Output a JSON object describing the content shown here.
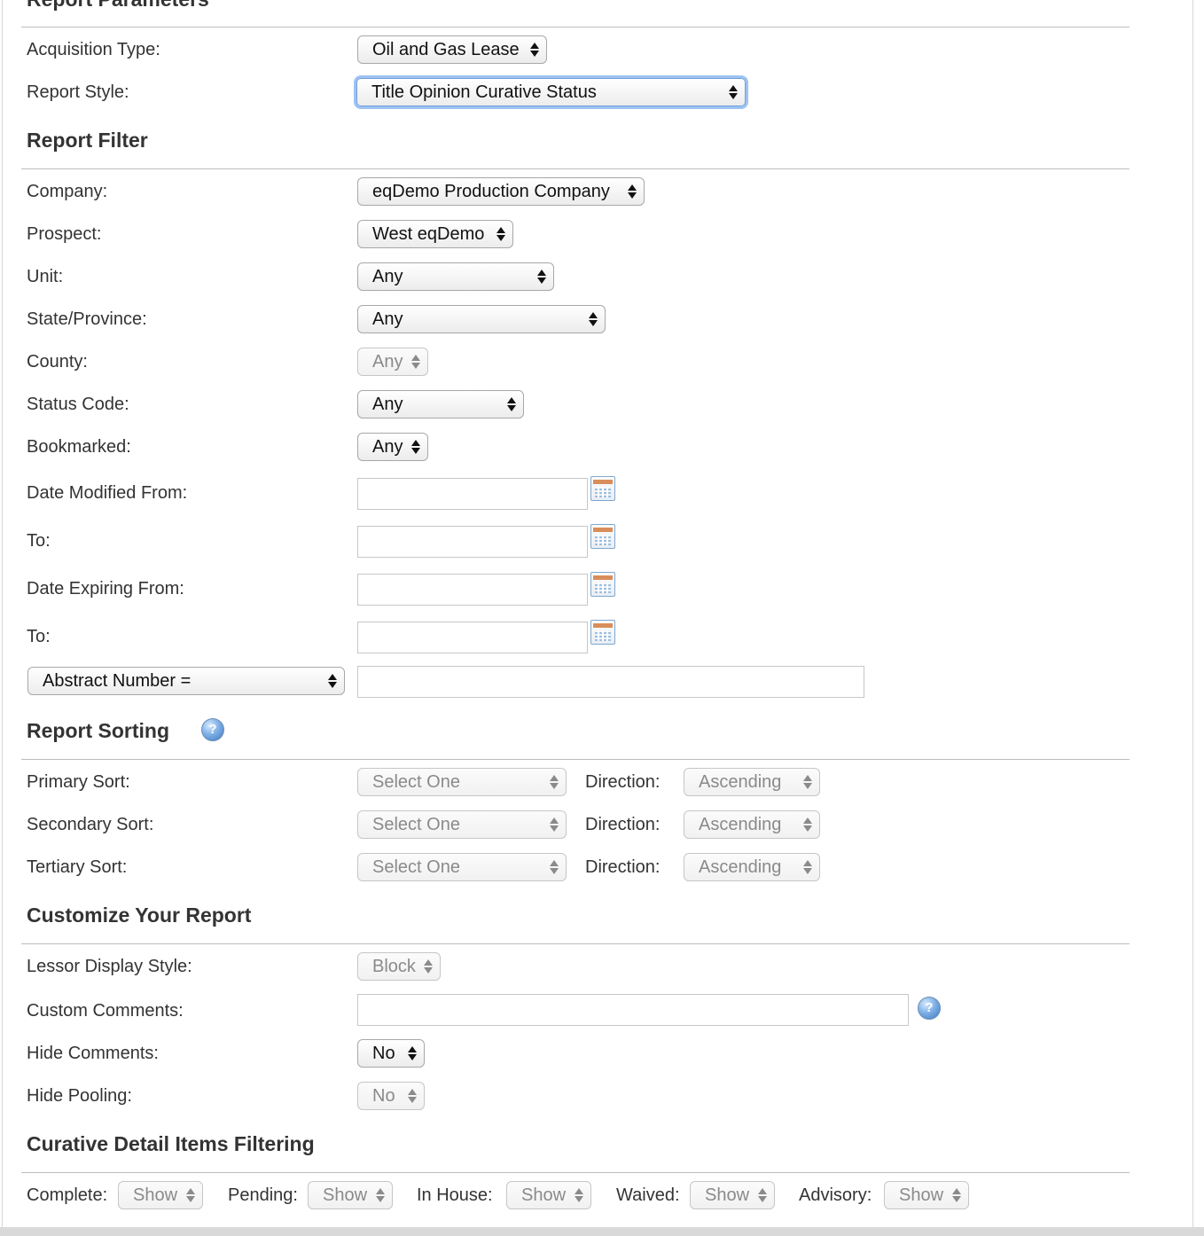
{
  "report_parameters": {
    "title": "Report Parameters",
    "acquisition_type": {
      "label": "Acquisition Type:",
      "value": "Oil and Gas Lease"
    },
    "report_style": {
      "label": "Report Style:",
      "value": "Title Opinion Curative Status"
    }
  },
  "report_filter": {
    "title": "Report Filter",
    "company": {
      "label": "Company:",
      "value": "eqDemo Production Company"
    },
    "prospect": {
      "label": "Prospect:",
      "value": "West eqDemo"
    },
    "unit": {
      "label": "Unit:",
      "value": "Any"
    },
    "state": {
      "label": "State/Province:",
      "value": "Any"
    },
    "county": {
      "label": "County:",
      "value": "Any"
    },
    "status_code": {
      "label": "Status Code:",
      "value": "Any"
    },
    "bookmarked": {
      "label": "Bookmarked:",
      "value": "Any"
    },
    "date_modified_from": {
      "label": "Date Modified From:",
      "value": ""
    },
    "date_modified_to": {
      "label": "To:",
      "value": ""
    },
    "date_expiring_from": {
      "label": "Date Expiring From:",
      "value": ""
    },
    "date_expiring_to": {
      "label": "To:",
      "value": ""
    },
    "field_selector": {
      "value": "Abstract Number ="
    },
    "field_value": ""
  },
  "report_sorting": {
    "title": "Report Sorting",
    "help_glyph": "?",
    "direction_label": "Direction:",
    "primary": {
      "label": "Primary Sort:",
      "value": "Select One",
      "direction": "Ascending"
    },
    "secondary": {
      "label": "Secondary Sort:",
      "value": "Select One",
      "direction": "Ascending"
    },
    "tertiary": {
      "label": "Tertiary Sort:",
      "value": "Select One",
      "direction": "Ascending"
    }
  },
  "customize": {
    "title": "Customize Your Report",
    "lessor_display_style": {
      "label": "Lessor Display Style:",
      "value": "Block"
    },
    "custom_comments": {
      "label": "Custom Comments:",
      "value": ""
    },
    "hide_comments": {
      "label": "Hide Comments:",
      "value": "No"
    },
    "hide_pooling": {
      "label": "Hide Pooling:",
      "value": "No"
    }
  },
  "curative_filtering": {
    "title": "Curative Detail Items Filtering",
    "complete": {
      "label": "Complete:",
      "value": "Show"
    },
    "pending": {
      "label": "Pending:",
      "value": "Show"
    },
    "in_house": {
      "label": "In House:",
      "value": "Show"
    },
    "waived": {
      "label": "Waived:",
      "value": "Show"
    },
    "advisory": {
      "label": "Advisory:",
      "value": "Show"
    }
  }
}
